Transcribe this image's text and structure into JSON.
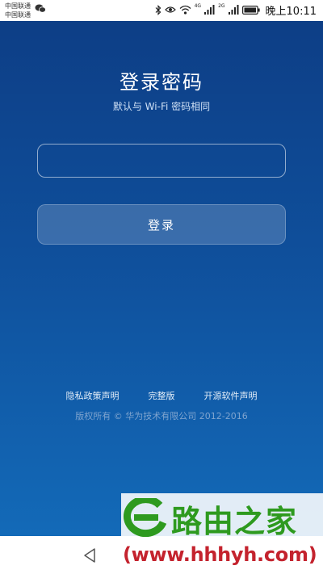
{
  "status_bar": {
    "carrier_1": "中国联通",
    "carrier_2": "中国联通",
    "net_4g": "4G",
    "net_2g": "2G",
    "time": "晚上10:11",
    "icons": [
      "wechat-icon",
      "bluetooth-icon",
      "eye-icon",
      "wifi-icon",
      "signal-icon",
      "battery-icon"
    ]
  },
  "login": {
    "title": "登录密码",
    "subtitle": "默认与 Wi-Fi 密码相同",
    "password_value": "",
    "button_label": "登录"
  },
  "footer": {
    "links": [
      "隐私政策声明",
      "完整版",
      "开源软件声明"
    ],
    "copyright": "版权所有 © 华为技术有限公司 2012-2016"
  },
  "watermark": {
    "title": "路由之家",
    "url": "(www.hhhyh.com)"
  },
  "navigation": {
    "icons": [
      "back-icon"
    ]
  },
  "colors": {
    "background_top": "#0d3e86",
    "background_bottom": "#136ab8",
    "watermark_green": "#2e9a1f",
    "watermark_red": "#c4232e"
  }
}
